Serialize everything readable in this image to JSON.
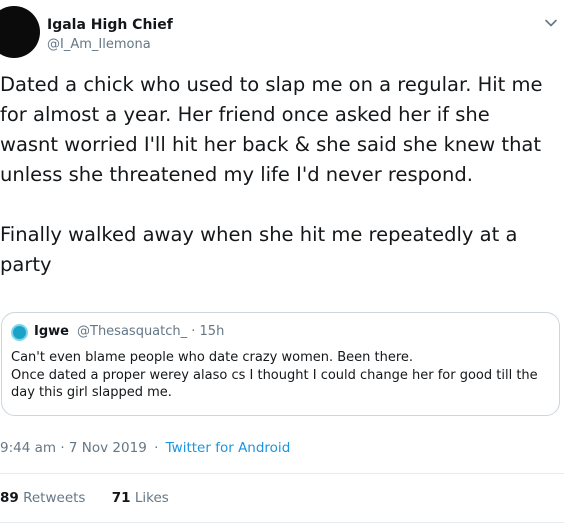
{
  "author": {
    "display_name": "Igala High Chief",
    "handle": "@I_Am_Ilemona",
    "menu_icon": "chevron-down-icon"
  },
  "tweet": {
    "paragraph_1": "Dated a chick who used to slap me on a regular. Hit me\nfor almost a year. Her friend once asked her if she\nwasnt worried I'll hit her back & she said she knew that\nunless she threatened my life I'd never respond.",
    "paragraph_2": "Finally walked away when she hit me repeatedly at a\nparty"
  },
  "quoted_tweet": {
    "display_name": "Igwe",
    "handle_time": "@Thesasquatch_ · 15h",
    "text": "Can't even blame people who date crazy women. Been there.\nOnce dated a proper werey alaso cs I thought I could change her for good till the\nday this girl slapped me."
  },
  "meta": {
    "time_date": "9:44 am · 7 Nov 2019",
    "separator": "·",
    "source": "Twitter for Android"
  },
  "stats": {
    "retweets_count": "89",
    "retweets_label": "Retweets",
    "likes_count": "71",
    "likes_label": "Likes"
  },
  "colors": {
    "text": "#14171a",
    "secondary": "#657786",
    "link": "#1b95e0",
    "border": "#ccd6dd"
  }
}
